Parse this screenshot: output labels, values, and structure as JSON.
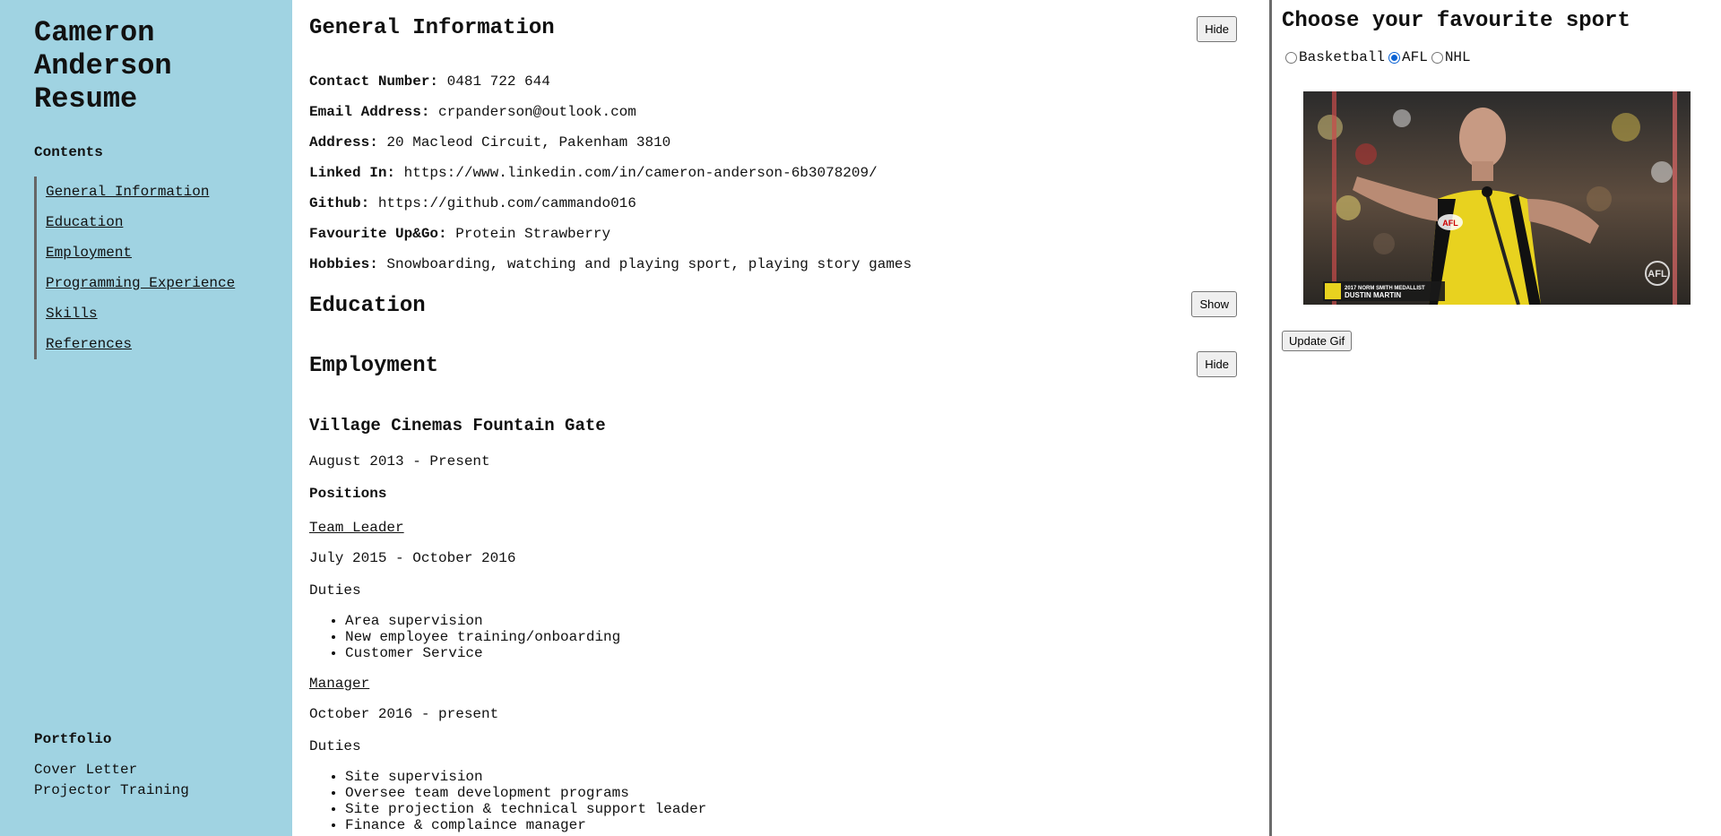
{
  "sidebar": {
    "name": "Cameron Anderson Resume",
    "contents_title": "Contents",
    "toc": [
      {
        "label": "General Information"
      },
      {
        "label": "Education"
      },
      {
        "label": "Employment"
      },
      {
        "label": "Programming Experience"
      },
      {
        "label": "Skills"
      },
      {
        "label": "References"
      }
    ],
    "portfolio_title": "Portfolio",
    "portfolio": [
      {
        "label": "Cover Letter"
      },
      {
        "label": "Projector Training"
      }
    ]
  },
  "general": {
    "title": "General Information",
    "toggle_label": "Hide",
    "fields": [
      {
        "label": "Contact Number:",
        "value": "0481 722 644"
      },
      {
        "label": "Email Address:",
        "value": "crpanderson@outlook.com"
      },
      {
        "label": "Address:",
        "value": "20 Macleod Circuit, Pakenham 3810"
      },
      {
        "label": "Linked In:",
        "value": "https://www.linkedin.com/in/cameron-anderson-6b3078209/"
      },
      {
        "label": "Github:",
        "value": "https://github.com/cammando016"
      },
      {
        "label": "Favourite Up&Go:",
        "value": "Protein Strawberry"
      },
      {
        "label": "Hobbies:",
        "value": "Snowboarding, watching and playing sport, playing story games"
      }
    ]
  },
  "education": {
    "title": "Education",
    "toggle_label": "Show"
  },
  "employment": {
    "title": "Employment",
    "toggle_label": "Hide",
    "employer": "Village Cinemas Fountain Gate",
    "period": "August 2013 - Present",
    "positions_label": "Positions",
    "roles": [
      {
        "title": "Team Leader",
        "period": "July 2015 - October 2016",
        "duties_label": "Duties",
        "duties": [
          "Area supervision",
          "New employee training/onboarding",
          "Customer Service"
        ]
      },
      {
        "title": "Manager",
        "period": "October 2016 - present",
        "duties_label": "Duties",
        "duties": [
          "Site supervision",
          "Oversee team development programs",
          "Site projection & technical support leader",
          "Finance & complaince manager"
        ]
      }
    ]
  },
  "sport": {
    "title": "Choose your favourite sport",
    "options": [
      {
        "label": "Basketball",
        "checked": false
      },
      {
        "label": "AFL",
        "checked": true
      },
      {
        "label": "NHL",
        "checked": false
      }
    ],
    "gif_caption_top": "2017 NORM SMITH MEDALLIST",
    "gif_caption_name": "DUSTIN MARTIN",
    "gif_watermark": "AFL",
    "gif_jumper_logo": "AFL",
    "update_label": "Update Gif"
  }
}
